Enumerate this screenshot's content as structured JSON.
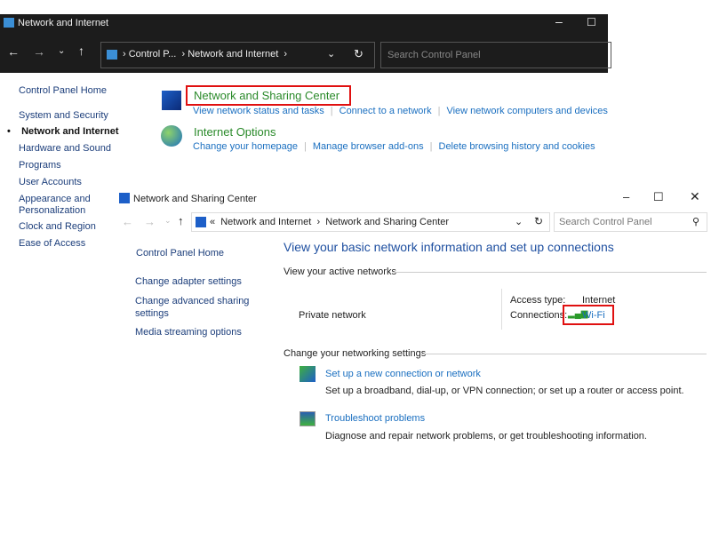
{
  "back": {
    "title": "Network and Internet",
    "breadcrumb": [
      "Control P...",
      "Network and Internet"
    ],
    "search_placeholder": "Search Control Panel",
    "sidebar": [
      "Control Panel Home",
      "System and Security",
      "Network and Internet",
      "Hardware and Sound",
      "Programs",
      "User Accounts",
      "Appearance and Personalization",
      "Clock and Region",
      "Ease of Access"
    ],
    "sections": [
      {
        "title": "Network and Sharing Center",
        "links": [
          "View network status and tasks",
          "Connect to a network",
          "View network computers and devices"
        ]
      },
      {
        "title": "Internet Options",
        "links": [
          "Change your homepage",
          "Manage browser add-ons",
          "Delete browsing history and cookies"
        ]
      }
    ]
  },
  "front": {
    "title": "Network and Sharing Center",
    "breadcrumb": [
      "Network and Internet",
      "Network and Sharing Center"
    ],
    "search_placeholder": "Search Control Panel",
    "sidebar": [
      "Control Panel Home",
      "Change adapter settings",
      "Change advanced sharing settings",
      "Media streaming options"
    ],
    "heading": "View your basic network information and set up connections",
    "active_label": "View your active networks",
    "network_name": "Private network",
    "access_label": "Access type:",
    "access_value": "Internet",
    "conn_label": "Connections:",
    "conn_value": "Wi-Fi",
    "change_label": "Change your networking settings",
    "tasks": [
      {
        "title": "Set up a new connection or network",
        "desc": "Set up a broadband, dial-up, or VPN connection; or set up a router or access point."
      },
      {
        "title": "Troubleshoot problems",
        "desc": "Diagnose and repair network problems, or get troubleshooting information."
      }
    ]
  }
}
